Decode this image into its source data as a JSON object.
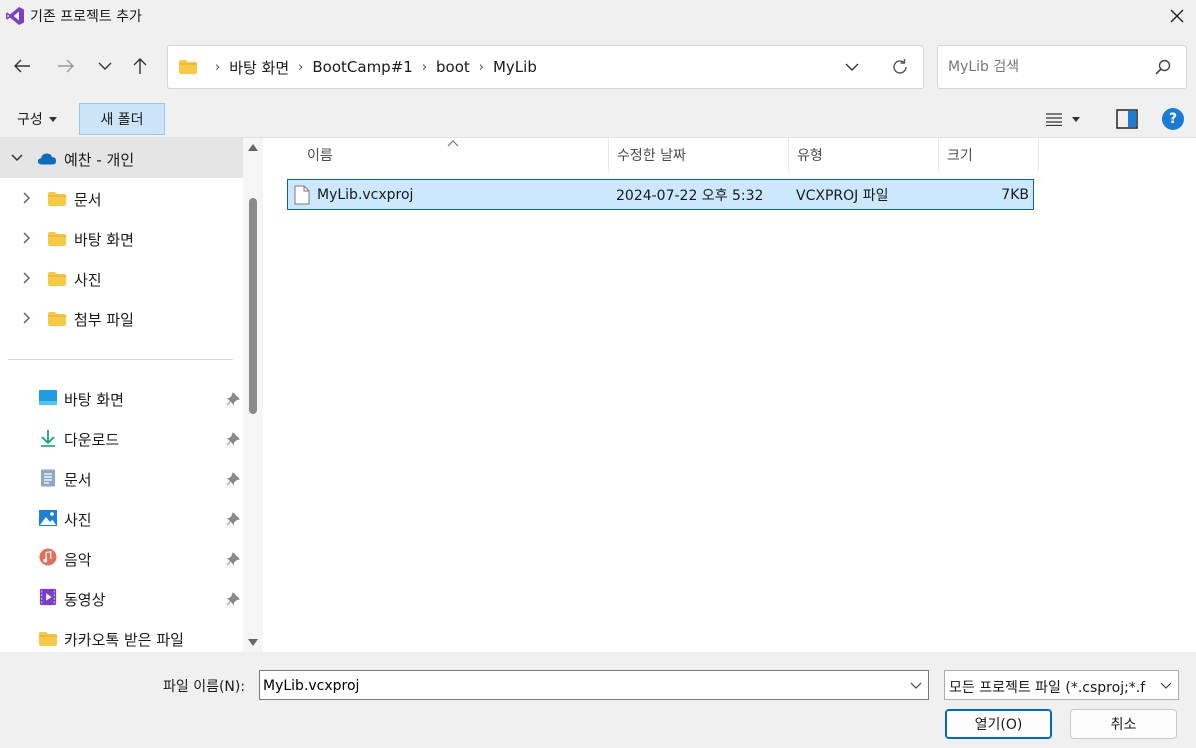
{
  "window": {
    "title": "기존 프로젝트 추가"
  },
  "nav": {
    "breadcrumbs": [
      "바탕 화면",
      "BootCamp#1",
      "boot",
      "MyLib"
    ],
    "search_placeholder": "MyLib 검색"
  },
  "toolbar": {
    "organize_label": "구성",
    "new_folder_label": "새 폴더"
  },
  "sidebar": {
    "tree": [
      {
        "label": "예찬 - 개인",
        "expanded": true,
        "icon": "onedrive-cloud-icon"
      },
      {
        "label": "문서",
        "icon": "folder-icon"
      },
      {
        "label": "바탕 화면",
        "icon": "folder-icon"
      },
      {
        "label": "사진",
        "icon": "folder-icon"
      },
      {
        "label": "첨부 파일",
        "icon": "folder-icon"
      }
    ],
    "quick_access": [
      {
        "label": "바탕 화면",
        "icon": "desktop-icon",
        "pinned": true
      },
      {
        "label": "다운로드",
        "icon": "download-icon",
        "pinned": true
      },
      {
        "label": "문서",
        "icon": "document-icon",
        "pinned": true
      },
      {
        "label": "사진",
        "icon": "pictures-icon",
        "pinned": true
      },
      {
        "label": "음악",
        "icon": "music-icon",
        "pinned": true
      },
      {
        "label": "동영상",
        "icon": "video-icon",
        "pinned": true
      },
      {
        "label": "카카오톡 받은 파일",
        "icon": "folder-icon",
        "pinned": false
      }
    ]
  },
  "filelist": {
    "columns": [
      "이름",
      "수정한 날짜",
      "유형",
      "크기"
    ],
    "rows": [
      {
        "name": "MyLib.vcxproj",
        "modified": "2024-07-22 오후 5:32",
        "type": "VCXPROJ 파일",
        "size": "7KB",
        "selected": true
      }
    ]
  },
  "bottom": {
    "filename_label": "파일 이름(N):",
    "filename_value": "MyLib.vcxproj",
    "filetype_value": "모든 프로젝트 파일 (*.csproj;*.f",
    "open_label": "열기(O)",
    "cancel_label": "취소"
  },
  "colors": {
    "accent": "#0067c0",
    "selection_bg": "#cce8ff",
    "selection_border": "#0d5fb0",
    "folder_yellow": "#f7c948",
    "chrome_bg": "#f0f0f0"
  }
}
